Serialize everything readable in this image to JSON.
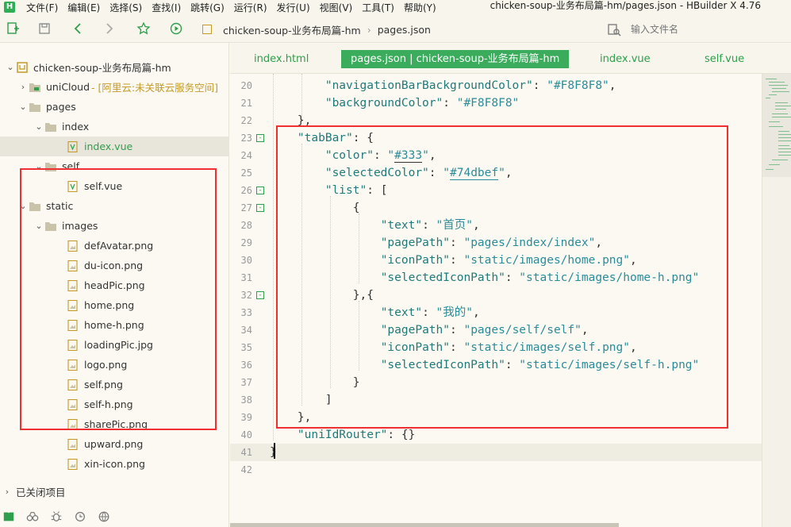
{
  "menubar": {
    "logo": "H",
    "items": [
      "文件(F)",
      "编辑(E)",
      "选择(S)",
      "查找(I)",
      "跳转(G)",
      "运行(R)",
      "发行(U)",
      "视图(V)",
      "工具(T)",
      "帮助(Y)"
    ],
    "window_title": "chicken-soup-业务布局篇-hm/pages.json - HBuilder X 4.76"
  },
  "toolbar": {
    "icons": [
      "new-file-icon",
      "save-icon",
      "back-icon",
      "forward-icon",
      "star-icon",
      "run-icon"
    ],
    "breadcrumb": [
      "chicken-soup-业务布局篇-hm",
      "pages.json"
    ],
    "file_search_placeholder": "输入文件名"
  },
  "sidebar": {
    "project": "chicken-soup-业务布局篇-hm",
    "unicloud": "uniCloud",
    "unicloud_hint": "- [阿里云:未关联云服务空间]",
    "pages": "pages",
    "index_folder": "index",
    "index_file": "index.vue",
    "self_folder": "self",
    "self_file": "self.vue",
    "static": "static",
    "images": "images",
    "image_files": [
      "defAvatar.png",
      "du-icon.png",
      "headPic.png",
      "home.png",
      "home-h.png",
      "loadingPic.jpg",
      "logo.png",
      "self.png",
      "self-h.png",
      "sharePic.png",
      "upward.png",
      "xin-icon.png"
    ],
    "closed_projects": "已关闭项目",
    "bottom_icons": [
      "book-icon",
      "binoculars-icon",
      "bug-icon",
      "cloud-refresh-icon",
      "globe-icon"
    ]
  },
  "tabs": [
    {
      "label": "index.html",
      "active": false
    },
    {
      "label": "pages.json | chicken-soup-业务布局篇-hm",
      "active": true
    },
    {
      "label": "index.vue",
      "active": false
    },
    {
      "label": "self.vue",
      "active": false
    }
  ],
  "editor": {
    "lines": [
      {
        "num": "20",
        "text": "        \"navigationBarBackgroundColor\": \"#F8F8F8\","
      },
      {
        "num": "21",
        "text": "        \"backgroundColor\": \"#F8F8F8\""
      },
      {
        "num": "22",
        "text": "    },"
      },
      {
        "num": "23",
        "text": "    \"tabBar\": {"
      },
      {
        "num": "24",
        "text": "        \"color\": \"#333\","
      },
      {
        "num": "25",
        "text": "        \"selectedColor\": \"#74dbef\","
      },
      {
        "num": "26",
        "text": "        \"list\": ["
      },
      {
        "num": "27",
        "text": "            {"
      },
      {
        "num": "28",
        "text": "                \"text\": \"首页\","
      },
      {
        "num": "29",
        "text": "                \"pagePath\": \"pages/index/index\","
      },
      {
        "num": "30",
        "text": "                \"iconPath\": \"static/images/home.png\","
      },
      {
        "num": "31",
        "text": "                \"selectedIconPath\": \"static/images/home-h.png\""
      },
      {
        "num": "32",
        "text": "            },{"
      },
      {
        "num": "33",
        "text": "                \"text\": \"我的\","
      },
      {
        "num": "34",
        "text": "                \"pagePath\": \"pages/self/self\","
      },
      {
        "num": "35",
        "text": "                \"iconPath\": \"static/images/self.png\","
      },
      {
        "num": "36",
        "text": "                \"selectedIconPath\": \"static/images/self-h.png\""
      },
      {
        "num": "37",
        "text": "            }"
      },
      {
        "num": "38",
        "text": "        ]"
      },
      {
        "num": "39",
        "text": "    },"
      },
      {
        "num": "40",
        "text": "    \"uniIdRouter\": {}"
      },
      {
        "num": "41",
        "text": "}"
      },
      {
        "num": "42",
        "text": ""
      }
    ],
    "fold_lines": [
      "23",
      "26",
      "27",
      "32"
    ]
  },
  "colors": {
    "accent_green": "#3BAB5C",
    "highlight_red": "#F03030",
    "background": "#FBF9F1"
  }
}
